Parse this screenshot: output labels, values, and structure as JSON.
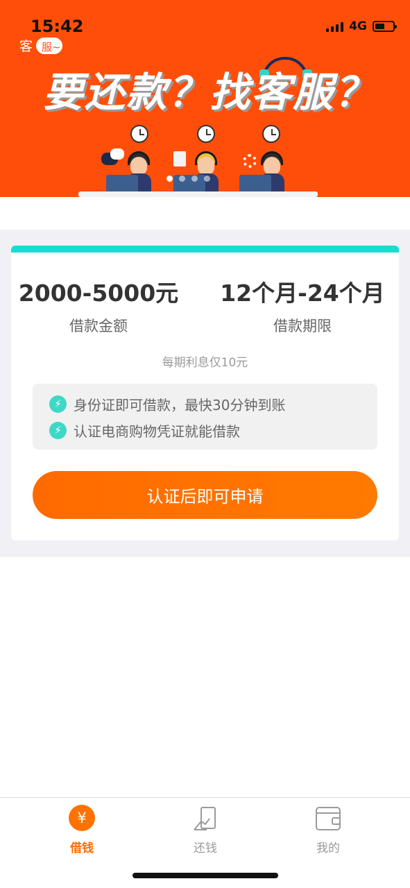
{
  "status_bar": {
    "time": "15:42",
    "network": "4G",
    "battery_level_pct": 45
  },
  "banner": {
    "tag_text": "客",
    "bubble_text": "服~",
    "headline": "要还款？找客服？",
    "carousel_dots": 4,
    "active_dot": 0,
    "bg_color": "#ff4e0a"
  },
  "loan_card": {
    "amount": {
      "value": "2000-5000元",
      "label": "借款金额"
    },
    "term": {
      "value": "12个月-24个月",
      "label": "借款期限"
    },
    "interest_note": "每期利息仅10元",
    "features": [
      {
        "icon": "lightning-icon",
        "text": "身份证即可借款，最快30分钟到账"
      },
      {
        "icon": "lightning-icon",
        "text": "认证电商购物凭证就能借款"
      }
    ],
    "apply_button": "认证后即可申请",
    "accent_color": "#17ddd0",
    "button_color": "#ff6a00"
  },
  "tabbar": {
    "items": [
      {
        "label": "借钱",
        "icon": "yen-icon",
        "active": true
      },
      {
        "label": "还钱",
        "icon": "repay-icon",
        "active": false
      },
      {
        "label": "我的",
        "icon": "wallet-icon",
        "active": false
      }
    ],
    "active_color": "#ff6a00"
  }
}
